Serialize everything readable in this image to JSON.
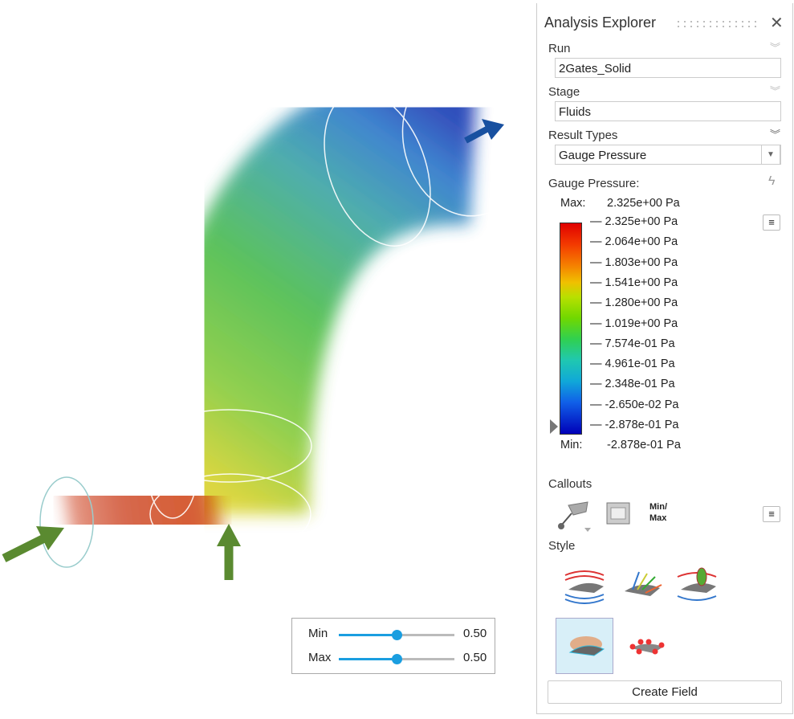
{
  "panel": {
    "title": "Analysis Explorer",
    "run": {
      "label": "Run",
      "value": "2Gates_Solid"
    },
    "stage": {
      "label": "Stage",
      "value": "Fluids"
    },
    "result_types": {
      "label": "Result Types",
      "value": "Gauge Pressure"
    },
    "legend": {
      "title": "Gauge Pressure:",
      "max_label": "Max:",
      "max_value": "2.325e+00 Pa",
      "min_label": "Min:",
      "min_value": "-2.878e-01 Pa",
      "ticks": [
        "2.325e+00 Pa",
        "2.064e+00 Pa",
        "1.803e+00 Pa",
        "1.541e+00 Pa",
        "1.280e+00 Pa",
        "1.019e+00 Pa",
        "7.574e-01 Pa",
        "4.961e-01 Pa",
        "2.348e-01 Pa",
        "-2.650e-02 Pa",
        "-2.878e-01 Pa"
      ]
    },
    "callouts": {
      "label": "Callouts",
      "minmax_label": "Min/\nMax"
    },
    "style": {
      "label": "Style"
    },
    "create_field": "Create Field"
  },
  "sliders": {
    "min": {
      "label": "Min",
      "value": "0.50",
      "fraction": 0.5
    },
    "max": {
      "label": "Max",
      "value": "0.50",
      "fraction": 0.5
    }
  }
}
